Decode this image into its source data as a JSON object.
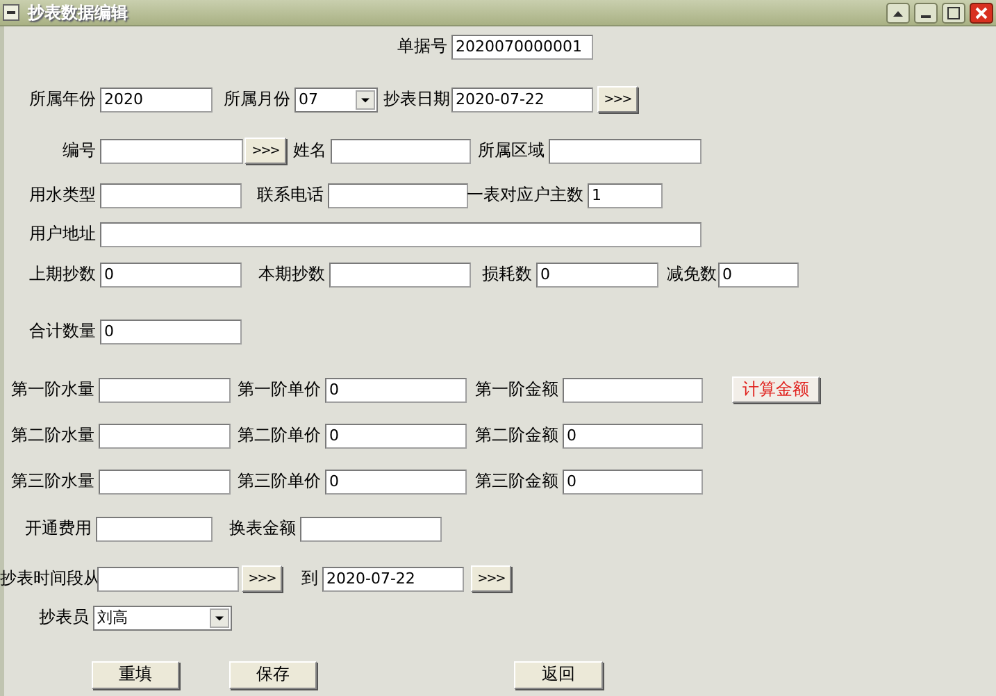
{
  "window": {
    "title": "抄表数据编辑"
  },
  "rows": [
    {
      "items": [
        {
          "kind": "field",
          "label": "单据号",
          "value": "2020070000001"
        }
      ]
    },
    {
      "items": [
        {
          "kind": "field",
          "label": "所属年份",
          "value": "2020"
        },
        {
          "kind": "select",
          "label": "所属月份",
          "value": "07"
        },
        {
          "kind": "field",
          "label": "抄表日期",
          "value": "2020-07-22"
        },
        {
          "kind": "browse",
          "label": ">>>"
        }
      ]
    },
    {
      "items": [
        {
          "kind": "field",
          "label": "编号"
        },
        {
          "kind": "browse",
          "label": ">>>"
        },
        {
          "kind": "field",
          "label": "姓名"
        },
        {
          "kind": "field",
          "label": "所属区域"
        }
      ]
    },
    {
      "items": [
        {
          "kind": "field",
          "label": "用水类型"
        },
        {
          "kind": "field",
          "label": "联系电话"
        },
        {
          "kind": "field",
          "label": "一表对应户主数",
          "value": "1"
        }
      ]
    },
    {
      "items": [
        {
          "kind": "field",
          "label": "用户地址"
        }
      ]
    },
    {
      "items": [
        {
          "kind": "field",
          "label": "上期抄数",
          "value": "0"
        },
        {
          "kind": "field",
          "label": "本期抄数"
        },
        {
          "kind": "field",
          "label": "损耗数",
          "value": "0"
        },
        {
          "kind": "field",
          "label": "减免数",
          "value": "0"
        }
      ]
    },
    {
      "items": [
        {
          "kind": "field",
          "label": "合计数量",
          "value": "0"
        }
      ]
    },
    {
      "items": [
        {
          "kind": "field",
          "label": "第一阶水量"
        },
        {
          "kind": "field",
          "label": "第一阶单价",
          "value": "0"
        },
        {
          "kind": "field",
          "label": "第一阶金额"
        },
        {
          "kind": "accent",
          "label": "计算金额"
        }
      ]
    },
    {
      "items": [
        {
          "kind": "field",
          "label": "第二阶水量"
        },
        {
          "kind": "field",
          "label": "第二阶单价",
          "value": "0"
        },
        {
          "kind": "field",
          "label": "第二阶金额",
          "value": "0"
        }
      ]
    },
    {
      "items": [
        {
          "kind": "field",
          "label": "第三阶水量"
        },
        {
          "kind": "field",
          "label": "第三阶单价",
          "value": "0"
        },
        {
          "kind": "field",
          "label": "第三阶金额",
          "value": "0"
        }
      ]
    },
    {
      "items": [
        {
          "kind": "field",
          "label": "开通费用"
        },
        {
          "kind": "field",
          "label": "换表金额"
        }
      ]
    },
    {
      "items": [
        {
          "kind": "field",
          "label": "抄表时间段从"
        },
        {
          "kind": "browse",
          "label": ">>>"
        },
        {
          "kind": "field",
          "label": "到",
          "value": "2020-07-22"
        },
        {
          "kind": "browse",
          "label": ">>>"
        }
      ]
    },
    {
      "items": [
        {
          "kind": "select",
          "label": "抄表员",
          "value": "刘高"
        }
      ]
    },
    {
      "items": [
        {
          "kind": "button",
          "label": "重填"
        },
        {
          "kind": "button",
          "label": "保存"
        },
        {
          "kind": "button",
          "label": "返回"
        }
      ]
    }
  ]
}
